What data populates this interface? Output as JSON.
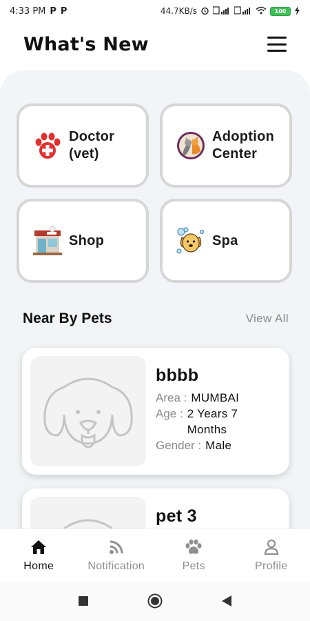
{
  "status_bar": {
    "time": "4:33 PM",
    "app_indicator_1": "P",
    "app_indicator_2": "P",
    "network_speed": "44.7KB/s",
    "battery_level": "100"
  },
  "header": {
    "title": "What's New"
  },
  "services": [
    {
      "label_line1": "Doctor",
      "label_line2": "(vet)",
      "icon": "vet-paw-icon"
    },
    {
      "label_line1": "Adoption",
      "label_line2": "Center",
      "icon": "adoption-center-icon"
    },
    {
      "label_line1": "Shop",
      "label_line2": "",
      "icon": "pet-shop-icon"
    },
    {
      "label_line1": "Spa",
      "label_line2": "",
      "icon": "dog-spa-icon"
    }
  ],
  "near_by": {
    "title": "Near By Pets",
    "view_all": "View All"
  },
  "pets": [
    {
      "name": "bbbb",
      "area_label": "Area :",
      "area": "MUMBAI",
      "age_label": "Age :",
      "age": "2 Years 7 Months",
      "gender_label": "Gender :",
      "gender": "Male"
    },
    {
      "name": "pet 3"
    }
  ],
  "bottom_nav": [
    {
      "label": "Home",
      "icon": "home-icon",
      "active": true
    },
    {
      "label": "Notification",
      "icon": "rss-icon",
      "active": false
    },
    {
      "label": "Pets",
      "icon": "paw-icon",
      "active": false
    },
    {
      "label": "Profile",
      "icon": "user-icon",
      "active": false
    }
  ],
  "colors": {
    "accent_red": "#e03131",
    "panel_bg": "#f3f4f7",
    "tile_border": "#d6d6d6",
    "muted_text": "#8a8a8a"
  }
}
